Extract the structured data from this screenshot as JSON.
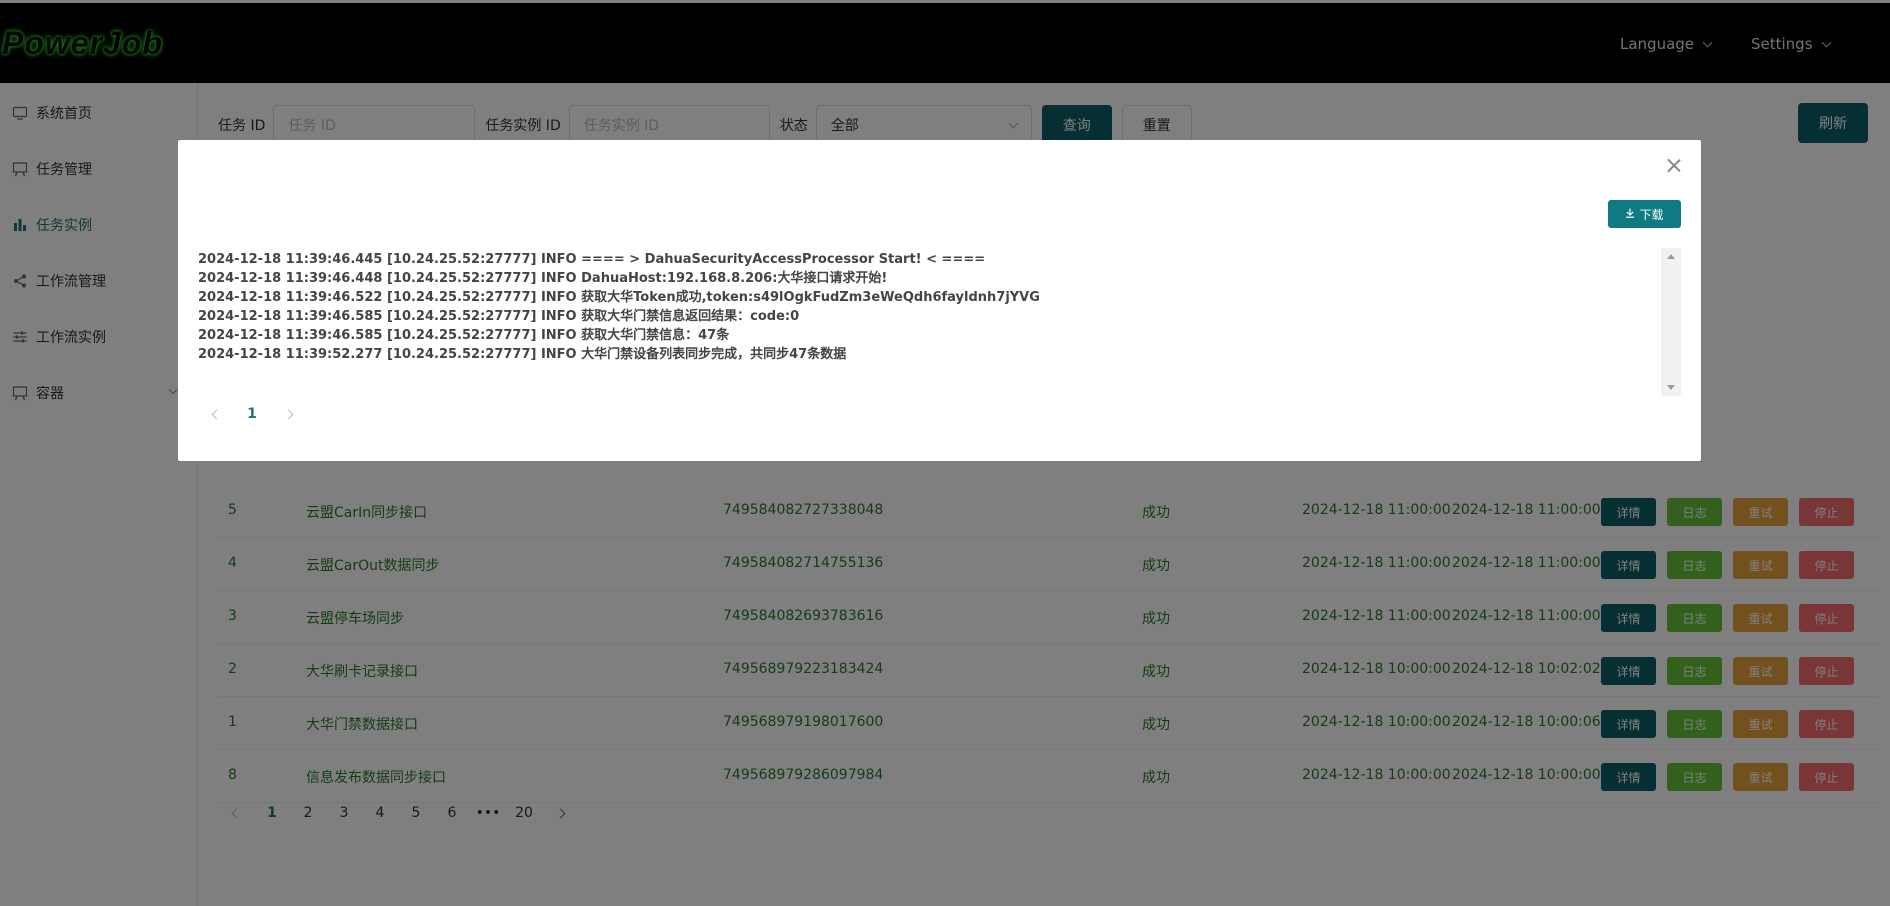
{
  "header": {
    "logo": "PowerJob",
    "language": "Language",
    "settings": "Settings"
  },
  "sidebar": {
    "items": [
      {
        "label": "系统首页",
        "icon": "monitor-icon"
      },
      {
        "label": "任务管理",
        "icon": "board-icon"
      },
      {
        "label": "任务实例",
        "icon": "bar-chart-icon"
      },
      {
        "label": "工作流管理",
        "icon": "share-icon"
      },
      {
        "label": "工作流实例",
        "icon": "sliders-icon"
      },
      {
        "label": "容器",
        "icon": "board-icon"
      }
    ]
  },
  "filter": {
    "task_id_label": "任务 ID",
    "task_id_placeholder": "任务 ID",
    "instance_id_label": "任务实例 ID",
    "instance_id_placeholder": "任务实例 ID",
    "status_label": "状态",
    "status_value": "全部",
    "query": "查询",
    "reset": "重置",
    "refresh": "刷新"
  },
  "ops": {
    "detail": "详情",
    "log": "日志",
    "retry": "重试",
    "stop": "停止"
  },
  "rows": [
    {
      "id": "5",
      "name": "云盟CarIn同步接口",
      "instance": "749584082727338048",
      "status": "成功",
      "start": "2024-12-18 11:00:00",
      "end": "2024-12-18 11:00:00"
    },
    {
      "id": "4",
      "name": "云盟CarOut数据同步",
      "instance": "749584082714755136",
      "status": "成功",
      "start": "2024-12-18 11:00:00",
      "end": "2024-12-18 11:00:00"
    },
    {
      "id": "3",
      "name": "云盟停车场同步",
      "instance": "749584082693783616",
      "status": "成功",
      "start": "2024-12-18 11:00:00",
      "end": "2024-12-18 11:00:00"
    },
    {
      "id": "2",
      "name": "大华刷卡记录接口",
      "instance": "749568979223183424",
      "status": "成功",
      "start": "2024-12-18 10:00:00",
      "end": "2024-12-18 10:02:02"
    },
    {
      "id": "1",
      "name": "大华门禁数据接口",
      "instance": "749568979198017600",
      "status": "成功",
      "start": "2024-12-18 10:00:00",
      "end": "2024-12-18 10:00:06"
    },
    {
      "id": "8",
      "name": "信息发布数据同步接口",
      "instance": "749568979286097984",
      "status": "成功",
      "start": "2024-12-18 10:00:00",
      "end": "2024-12-18 10:00:00"
    }
  ],
  "pagination": [
    "1",
    "2",
    "3",
    "4",
    "5",
    "6",
    "•••",
    "20"
  ],
  "modal": {
    "download": "下载",
    "logs": [
      "2024-12-18 11:39:46.445 [10.24.25.52:27777] INFO ==== > DahuaSecurityAccessProcessor Start!  < ====",
      "2024-12-18 11:39:46.448 [10.24.25.52:27777] INFO DahuaHost:192.168.8.206:大华接口请求开始!",
      "2024-12-18 11:39:46.522 [10.24.25.52:27777] INFO 获取大华Token成功,token:s49lOgkFudZm3eWeQdh6fayldnh7jYVG",
      "2024-12-18 11:39:46.585 [10.24.25.52:27777] INFO 获取大华门禁信息返回结果：code:0",
      "2024-12-18 11:39:46.585 [10.24.25.52:27777] INFO 获取大华门禁信息：47条",
      "2024-12-18 11:39:52.277 [10.24.25.52:27777] INFO 大华门禁设备列表同步完成，共同步47条数据"
    ],
    "page": "1"
  }
}
